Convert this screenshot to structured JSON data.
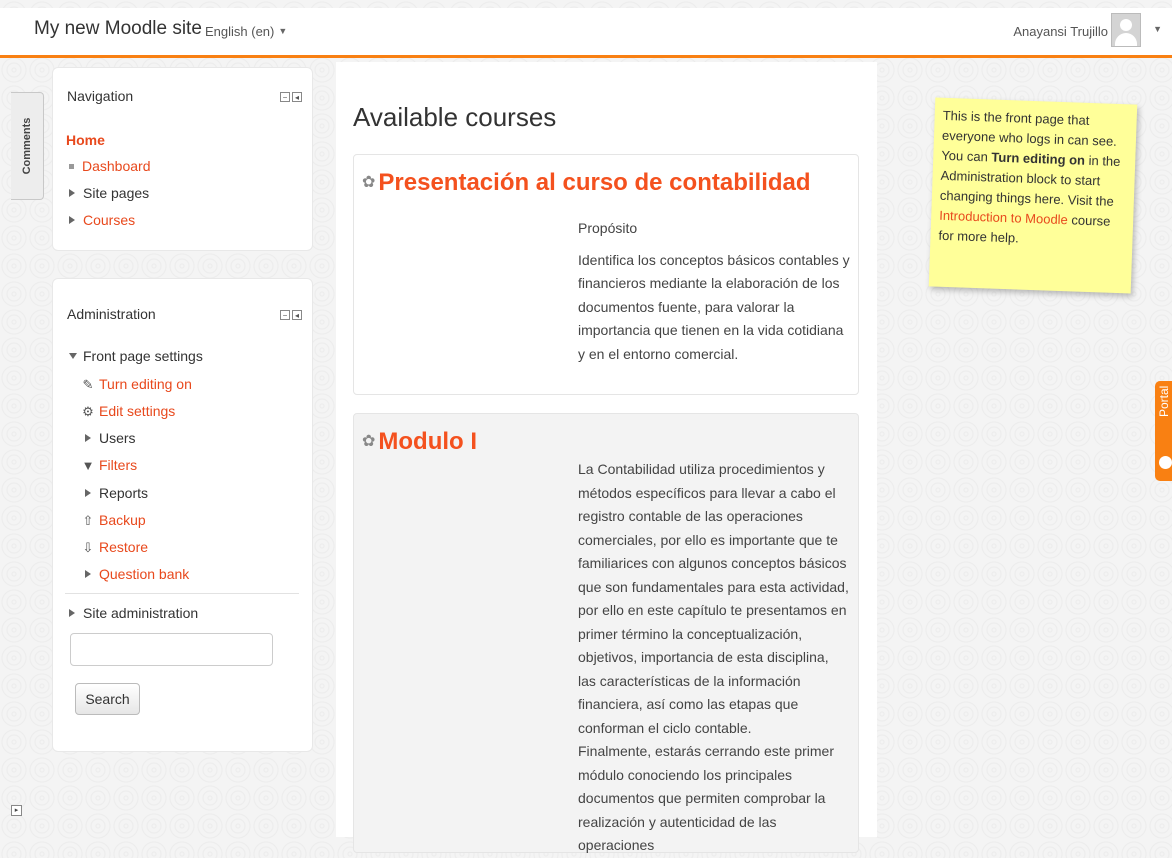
{
  "header": {
    "site_name": "My new Moodle site",
    "language": "English (en)",
    "user_name": "Anayansi Trujillo"
  },
  "comments_tab": {
    "label": "Comments"
  },
  "navigation": {
    "title": "Navigation",
    "home": "Home",
    "items": [
      {
        "label": "Dashboard"
      },
      {
        "label": "Site pages"
      },
      {
        "label": "Courses"
      }
    ]
  },
  "administration": {
    "title": "Administration",
    "front_page_settings": "Front page settings",
    "items": [
      {
        "label": "Turn editing on",
        "icon": "pencil-icon"
      },
      {
        "label": "Edit settings",
        "icon": "gear-icon"
      },
      {
        "label": "Users",
        "icon": "expand-arrow-icon"
      },
      {
        "label": "Filters",
        "icon": "filter-icon"
      },
      {
        "label": "Reports",
        "icon": "expand-arrow-icon"
      },
      {
        "label": "Backup",
        "icon": "backup-icon"
      },
      {
        "label": "Restore",
        "icon": "restore-icon"
      },
      {
        "label": "Question bank",
        "icon": "expand-arrow-icon"
      }
    ],
    "site_administration": "Site administration",
    "search_placeholder": "",
    "search_button": "Search"
  },
  "main": {
    "heading": "Available courses",
    "courses": [
      {
        "title": "Presentación al curso de contabilidad",
        "paragraphs": [
          "Propósito",
          "Identifica los conceptos básicos contables y financieros mediante la elaboración de los documentos fuente, para valorar la importancia que tienen en la vida cotidiana y en el entorno comercial."
        ]
      },
      {
        "title": "Modulo I",
        "paragraphs": [
          "La Contabilidad utiliza procedimientos y métodos específicos para llevar a cabo el registro contable de las operaciones comerciales, por ello es importante que te familiarices con algunos conceptos básicos que son fundamentales para esta actividad, por ello en este capítulo te presentamos en primer término la conceptualización, objetivos, importancia de esta disciplina, las características de la información financiera, así como las etapas que conforman el ciclo contable.",
          "Finalmente, estarás cerrando este primer módulo conociendo los principales documentos que permiten comprobar la realización y autenticidad de las operaciones"
        ]
      }
    ]
  },
  "note": {
    "text_1": "This is the front page that everyone who logs in can see.  You can ",
    "bold": "Turn editing on",
    "text_2": " in the Administration block to start changing things here.  Visit the ",
    "link": "Introduction to Moodle",
    "text_3": " course for more help."
  },
  "portal_tab": {
    "label": "Portal"
  },
  "colors": {
    "accent": "#f98012",
    "link": "#e8491d",
    "note_bg": "#ffff99"
  }
}
